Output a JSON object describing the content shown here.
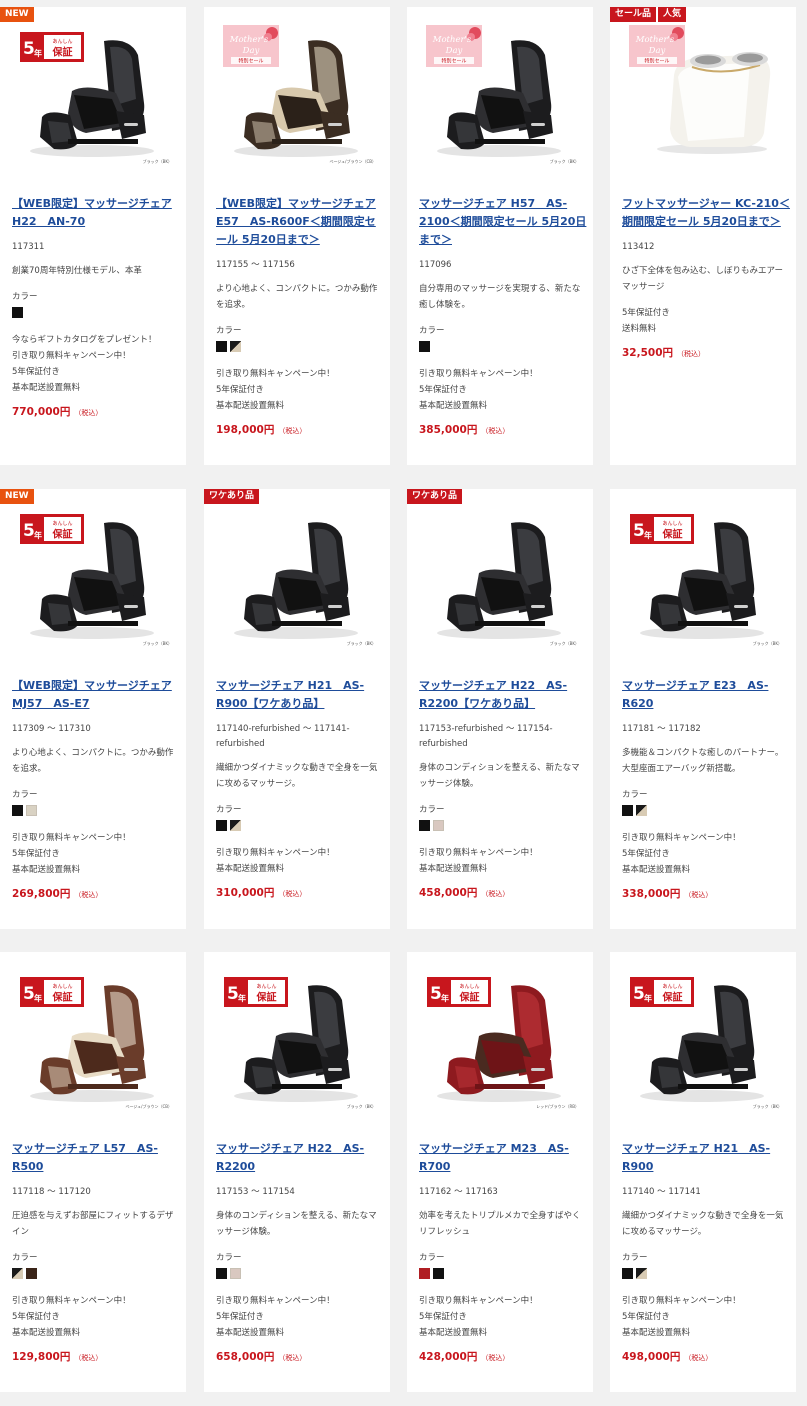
{
  "colors": {
    "link": "#1e4c9a",
    "price": "#c8161d",
    "badge_new": "#e8520f",
    "badge_red": "#c8161d",
    "page_bg": "#f1f1f1"
  },
  "common": {
    "color_label": "カラー",
    "tax_label": "（税込）",
    "warranty": {
      "years": "5",
      "unit": "年",
      "anshin": "あんしん",
      "hosho": "保証"
    },
    "mothers_day": {
      "line1": "Mother's",
      "line2": "Day",
      "sale": "特別セール"
    }
  },
  "products": [
    {
      "badges": [
        {
          "label": "NEW",
          "kind": "new"
        }
      ],
      "overlay": "warranty",
      "image_caption": "ブラック（BK）",
      "image_icon": "massage-chair-black",
      "name": "【WEB限定】マッサージチェア H22　AN-70",
      "code": "117311",
      "description": "創業70周年特別仕様モデル、本革",
      "colors": [
        "#111111"
      ],
      "notes": [
        "今ならギフトカタログをプレゼント！",
        "引き取り無料キャンペーン中！",
        "5年保証付き",
        "基本配送設置無料"
      ],
      "price": "770,000円"
    },
    {
      "badges": [],
      "overlay": "mothers",
      "image_caption": "ベージュ/ブラウン（CB）",
      "image_icon": "massage-chair-beige-brown",
      "name": "【WEB限定】マッサージチェア E57　AS-R600F＜期間限定セール 5月20日まで＞",
      "code": "117155 ～ 117156",
      "description": "より心地よく、コンパクトに。つかみ動作を追求。",
      "colors": [
        "#111111",
        "diag"
      ],
      "notes": [
        "引き取り無料キャンペーン中！",
        "5年保証付き",
        "基本配送設置無料"
      ],
      "price": "198,000円"
    },
    {
      "badges": [],
      "overlay": "mothers",
      "image_caption": "ブラック（BK）",
      "image_icon": "massage-chair-black",
      "name": "マッサージチェア H57　AS-2100＜期間限定セール 5月20日まで＞",
      "code": "117096",
      "description": "自分専用のマッサージを実現する、新たな癒し体験を。",
      "colors": [
        "#111111"
      ],
      "notes": [
        "引き取り無料キャンペーン中！",
        "5年保証付き",
        "基本配送設置無料"
      ],
      "price": "385,000円"
    },
    {
      "badges": [
        {
          "label": "セール品",
          "kind": "red"
        },
        {
          "label": "人気",
          "kind": "red"
        }
      ],
      "overlay": "mothers",
      "image_caption": "",
      "image_icon": "foot-massager-white",
      "name": "フットマッサージャー KC-210＜期間限定セール 5月20日まで＞",
      "code": "113412",
      "description": "ひざ下全体を包み込む、しぼりもみエアーマッサージ",
      "colors": [],
      "notes": [
        "5年保証付き",
        "送料無料"
      ],
      "price": "32,500円"
    },
    {
      "badges": [
        {
          "label": "NEW",
          "kind": "new"
        }
      ],
      "overlay": "warranty",
      "image_caption": "ブラック（BK）",
      "image_icon": "massage-chair-black",
      "name": "【WEB限定】マッサージチェア MJ57　AS-E7",
      "code": "117309 ～ 117310",
      "description": "より心地よく、コンパクトに。つかみ動作を追求。",
      "colors": [
        "#111111",
        "#d9d2c3"
      ],
      "notes": [
        "引き取り無料キャンペーン中！",
        "5年保証付き",
        "基本配送設置無料"
      ],
      "price": "269,800円"
    },
    {
      "badges": [
        {
          "label": "ワケあり品",
          "kind": "red"
        }
      ],
      "overlay": "",
      "image_caption": "ブラック（BK）",
      "image_icon": "massage-chair-black",
      "name": "マッサージチェア H21　AS-R900【ワケあり品】",
      "code": "117140-refurbished ～ 117141-refurbished",
      "description": "繊細かつダイナミックな動きで全身を一気に攻めるマッサージ。",
      "colors": [
        "#111111",
        "diag"
      ],
      "notes": [
        "引き取り無料キャンペーン中！",
        "基本配送設置無料"
      ],
      "price": "310,000円"
    },
    {
      "badges": [
        {
          "label": "ワケあり品",
          "kind": "red"
        }
      ],
      "overlay": "",
      "image_caption": "ブラック（BK）",
      "image_icon": "massage-chair-black",
      "name": "マッサージチェア H22　AS-R2200【ワケあり品】",
      "code": "117153-refurbished ～ 117154-refurbished",
      "description": "身体のコンディションを整える、新たなマッサージ体験。",
      "colors": [
        "#111111",
        "#d9c8c0"
      ],
      "notes": [
        "引き取り無料キャンペーン中！",
        "基本配送設置無料"
      ],
      "price": "458,000円"
    },
    {
      "badges": [],
      "overlay": "warranty",
      "image_caption": "ブラック（BK）",
      "image_icon": "massage-chair-black",
      "name": "マッサージチェア E23　AS-R620",
      "code": "117181 ～ 117182",
      "description": "多機能＆コンパクトな癒しのパートナー。大型座面エアーバッグ新搭載。",
      "colors": [
        "#111111",
        "diag"
      ],
      "notes": [
        "引き取り無料キャンペーン中！",
        "5年保証付き",
        "基本配送設置無料"
      ],
      "price": "338,000円"
    },
    {
      "badges": [],
      "overlay": "warranty",
      "image_caption": "ベージュ/ブラウン（CB）",
      "image_icon": "massage-chair-brown-beige",
      "name": "マッサージチェア L57　AS-R500",
      "code": "117118 ～ 117120",
      "description": "圧迫感を与えずお部屋にフィットするデザイン",
      "colors": [
        "diag",
        "#3a2418"
      ],
      "notes": [
        "引き取り無料キャンペーン中！",
        "5年保証付き",
        "基本配送設置無料"
      ],
      "price": "129,800円"
    },
    {
      "badges": [],
      "overlay": "warranty",
      "image_caption": "ブラック（BK）",
      "image_icon": "massage-chair-black",
      "name": "マッサージチェア H22　AS-R2200",
      "code": "117153 ～ 117154",
      "description": "身体のコンディションを整える、新たなマッサージ体験。",
      "colors": [
        "#111111",
        "#d9c8c0"
      ],
      "notes": [
        "引き取り無料キャンペーン中！",
        "5年保証付き",
        "基本配送設置無料"
      ],
      "price": "658,000円"
    },
    {
      "badges": [],
      "overlay": "warranty",
      "image_caption": "レッド/ブラウン（RB）",
      "image_icon": "massage-chair-red",
      "name": "マッサージチェア M23　AS-R700",
      "code": "117162 ～ 117163",
      "description": "効率を考えたトリプルメカで全身すばやくリフレッシュ",
      "colors": [
        "#b01e23",
        "#111111"
      ],
      "notes": [
        "引き取り無料キャンペーン中！",
        "5年保証付き",
        "基本配送設置無料"
      ],
      "price": "428,000円"
    },
    {
      "badges": [],
      "overlay": "warranty",
      "image_caption": "ブラック（BK）",
      "image_icon": "massage-chair-black",
      "name": "マッサージチェア H21　AS-R900",
      "code": "117140 ～ 117141",
      "description": "繊細かつダイナミックな動きで全身を一気に攻めるマッサージ。",
      "colors": [
        "#111111",
        "diag"
      ],
      "notes": [
        "引き取り無料キャンペーン中！",
        "5年保証付き",
        "基本配送設置無料"
      ],
      "price": "498,000円"
    }
  ]
}
